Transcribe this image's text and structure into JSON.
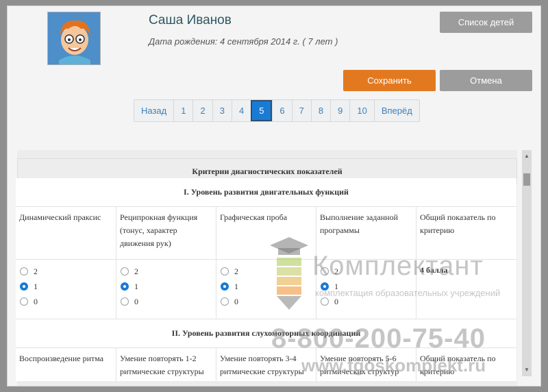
{
  "child": {
    "name": "Саша Иванов",
    "dob_label": "Дата рождения: 4 сентября 2014 г. ( 7 лет )"
  },
  "buttons": {
    "children_list": "Список детей",
    "save": "Сохранить",
    "cancel": "Отмена"
  },
  "pagination": {
    "prev": "Назад",
    "next": "Вперёд",
    "pages": [
      "1",
      "2",
      "3",
      "4",
      "5",
      "6",
      "7",
      "8",
      "9",
      "10"
    ],
    "active": "5"
  },
  "table": {
    "header": "Критерии диагностических показателей",
    "section1": {
      "title": "I. Уровень развития двигательных функций",
      "columns": [
        "Динамический праксис",
        "Реципрокная функция (тонус, характер движения рук)",
        "Графическая проба",
        "Выполнение заданной программы",
        "Общий показатель по критерию"
      ],
      "options": [
        "2",
        "1",
        "0"
      ],
      "selected": [
        "1",
        "1",
        "1",
        "1"
      ],
      "total": "4 балла"
    },
    "section2": {
      "title": "II. Уровень развития слухомоторных координаций",
      "columns": [
        "Воспроизведение ритма",
        "Умение повторять 1-2 ритмические структуры",
        "Умение повторять 3-4 ритмические структуры",
        "Умение повторять 5-6 ритмических структур",
        "Общий показатель по критерию"
      ]
    }
  },
  "watermark": {
    "brand": "Комплектант",
    "tagline": "комплектация образовательных учреждений",
    "phone": "8-800-200-75-40",
    "site": "www.fgoskomplekt.ru"
  },
  "colors": {
    "accent": "#1a7bd4",
    "save": "#e2791f",
    "neutral_button": "#9c9c9c"
  }
}
